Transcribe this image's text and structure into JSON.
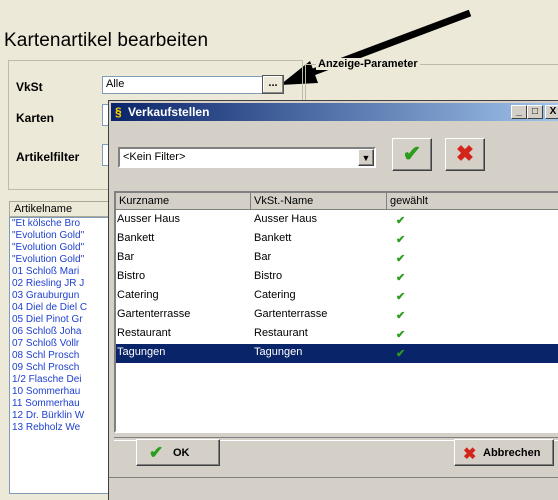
{
  "page": {
    "title": "Kartenartikel bearbeiten",
    "vkst_label": "VkSt",
    "vkst_value": "Alle",
    "ellipsis_label": "...",
    "karten_label": "Karten",
    "artikelfilter_label": "Artikelfilter",
    "anzeige_label": "Anzeige-Parameter",
    "artikel_header": "Artikelname",
    "artikel_items": [
      "\"Et kölsche Bro",
      "\"Evolution Gold\"",
      "\"Evolution Gold\"",
      "\"Evolution Gold\"",
      "01 Schloß Mari",
      "02 Riesling JR J",
      "03 Grauburgun",
      "04 Diel de Diel C",
      "05 Diel Pinot Gr",
      "06 Schloß Joha",
      "07 Schloß Vollr",
      "08 Schl Prosch",
      "09 Schl Prosch",
      "1/2 Flasche Dei",
      "10 Sommerhau",
      "11 Sommerhau",
      "12 Dr. Bürklin W",
      "13 Rebholz We"
    ]
  },
  "dialog": {
    "title": "Verkaufstellen",
    "filter_value": "<Kein Filter>",
    "columns": [
      "Kurzname",
      "VkSt.-Name",
      "gewählt"
    ],
    "rows": [
      {
        "kurz": "Ausser Haus",
        "name": "Ausser Haus",
        "gewaehlt": "✔"
      },
      {
        "kurz": "Bankett",
        "name": "Bankett",
        "gewaehlt": "✔"
      },
      {
        "kurz": "Bar",
        "name": "Bar",
        "gewaehlt": "✔"
      },
      {
        "kurz": "Bistro",
        "name": "Bistro",
        "gewaehlt": "✔"
      },
      {
        "kurz": "Catering",
        "name": "Catering",
        "gewaehlt": "✔"
      },
      {
        "kurz": "Gartenterrasse",
        "name": "Gartenterrasse",
        "gewaehlt": "✔"
      },
      {
        "kurz": "Restaurant",
        "name": "Restaurant",
        "gewaehlt": "✔"
      },
      {
        "kurz": "Tagungen",
        "name": "Tagungen",
        "gewaehlt": "✔"
      }
    ],
    "ok_label": "OK",
    "cancel_label": "Abbrechen",
    "minimize_label": "_",
    "maximize_label": "□",
    "close_label": "X"
  }
}
